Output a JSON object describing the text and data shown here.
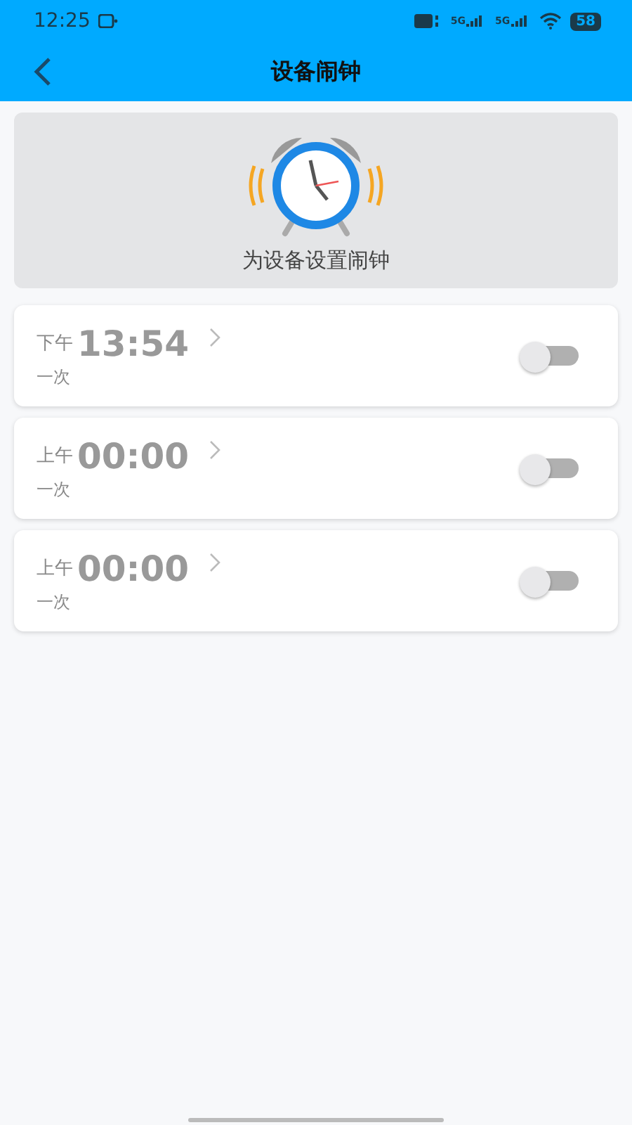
{
  "status_bar": {
    "time": "12:25",
    "signals": [
      "5G",
      "5G"
    ],
    "battery": "58"
  },
  "app_bar": {
    "title": "设备闹钟"
  },
  "banner": {
    "caption": "为设备设置闹钟"
  },
  "alarms": [
    {
      "period": "下午",
      "time": "13:54",
      "repeat": "一次",
      "on": false
    },
    {
      "period": "上午",
      "time": "00:00",
      "repeat": "一次",
      "on": false
    },
    {
      "period": "上午",
      "time": "00:00",
      "repeat": "一次",
      "on": false
    }
  ]
}
